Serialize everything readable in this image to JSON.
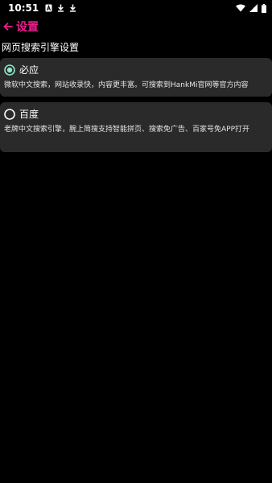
{
  "status_bar": {
    "time": "10:51",
    "icons_left": [
      "a-letter-icon",
      "download-icon",
      "download-icon"
    ],
    "icons_right": [
      "wifi-icon",
      "signal-icon",
      "battery-icon"
    ]
  },
  "app_bar": {
    "back_icon": "arrow-left-icon",
    "title": "设置",
    "accent_color": "#e91e8c"
  },
  "section": {
    "title": "网页搜索引擎设置"
  },
  "options": [
    {
      "label": "必应",
      "description": "微软中文搜索，网站收录快，内容更丰富。可搜索到HankMi官网等官方内容",
      "selected": true
    },
    {
      "label": "百度",
      "description": "老牌中文搜索引擎，腕上简搜支持智能拼页、搜索免广告、百家号免APP打开",
      "selected": false
    }
  ],
  "colors": {
    "background": "#000000",
    "card": "#2a2a2a",
    "radio_selected": "#8fe5c8",
    "radio_unselected": "#ffffff"
  }
}
